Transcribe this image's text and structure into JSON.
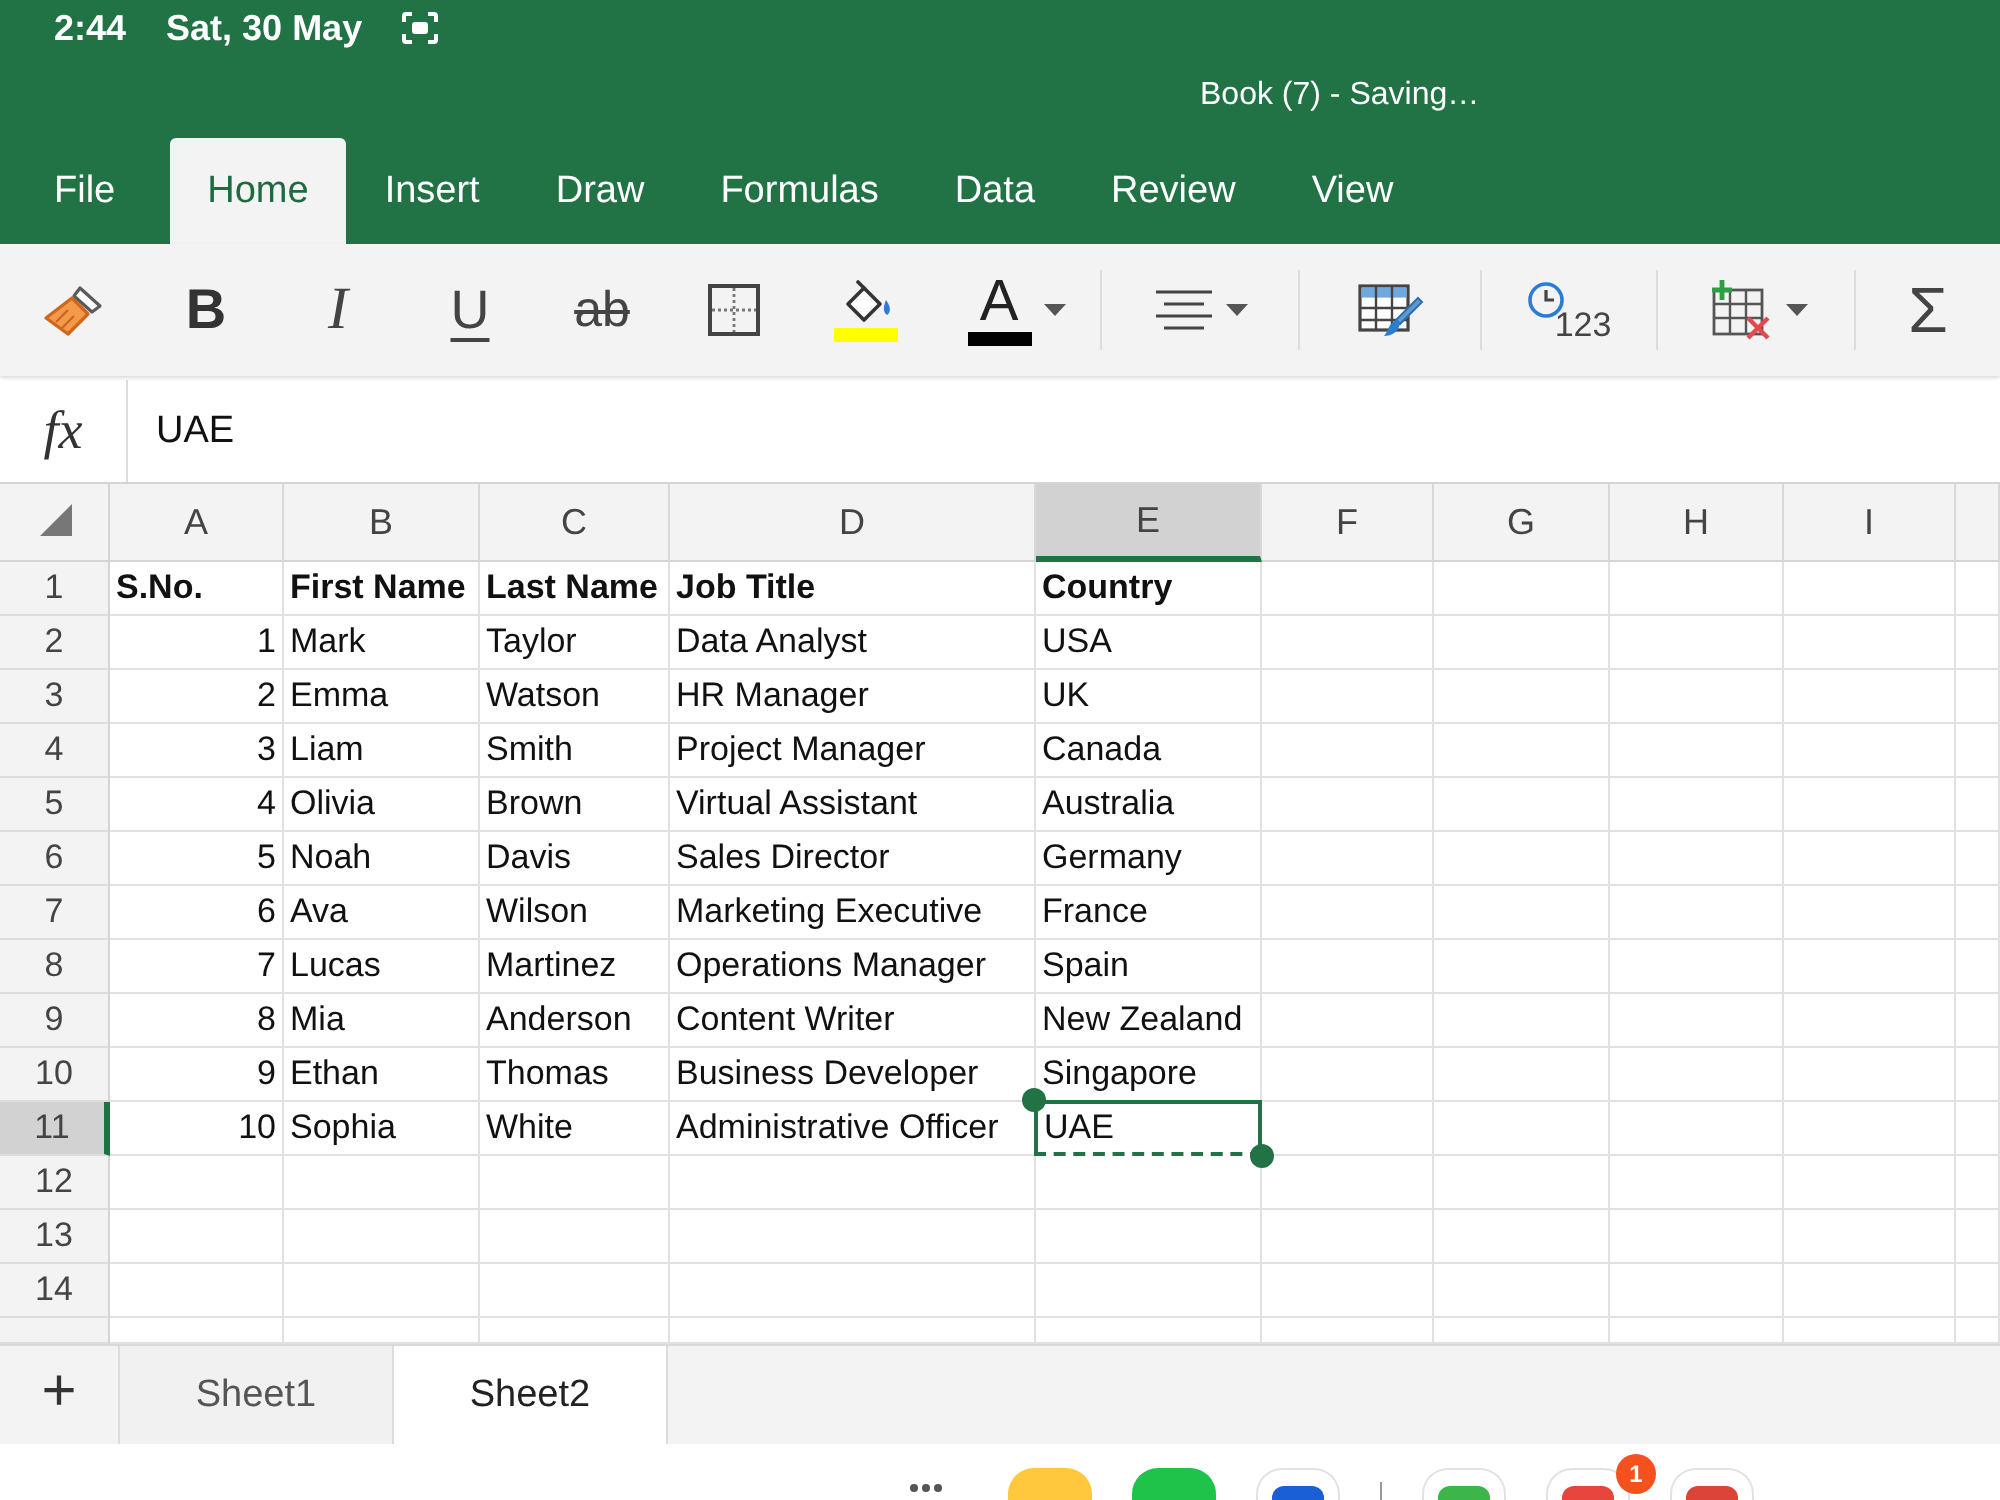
{
  "status_bar": {
    "time": "2:44",
    "date": "Sat, 30 May"
  },
  "window": {
    "title": "Book (7) - Saving…"
  },
  "ribbon_tabs": [
    {
      "label": "File",
      "selected": false
    },
    {
      "label": "Home",
      "selected": true
    },
    {
      "label": "Insert",
      "selected": false
    },
    {
      "label": "Draw",
      "selected": false
    },
    {
      "label": "Formulas",
      "selected": false
    },
    {
      "label": "Data",
      "selected": false
    },
    {
      "label": "Review",
      "selected": false
    },
    {
      "label": "View",
      "selected": false
    }
  ],
  "toolbar": {
    "groups": [
      {
        "items": [
          {
            "kind": "format-painter",
            "dropdown": false
          },
          {
            "kind": "bold",
            "text": "B",
            "dropdown": false
          },
          {
            "kind": "italic",
            "text": "I",
            "dropdown": false
          },
          {
            "kind": "underline",
            "text": "U",
            "dropdown": false
          },
          {
            "kind": "strikethrough",
            "text": "ab",
            "dropdown": false
          },
          {
            "kind": "borders",
            "dropdown": false
          },
          {
            "kind": "fill-color",
            "color": "#ffff00",
            "dropdown": false
          },
          {
            "kind": "font-color",
            "text": "A",
            "color": "#000000",
            "dropdown": true
          }
        ]
      },
      {
        "items": [
          {
            "kind": "align",
            "dropdown": true
          }
        ]
      },
      {
        "items": [
          {
            "kind": "format-table",
            "dropdown": false
          }
        ]
      },
      {
        "items": [
          {
            "kind": "number-format",
            "text": "123",
            "dropdown": false
          }
        ]
      },
      {
        "items": [
          {
            "kind": "insert-delete",
            "dropdown": true
          }
        ]
      },
      {
        "items": [
          {
            "kind": "autosum",
            "text": "Σ",
            "dropdown": false
          }
        ]
      }
    ]
  },
  "formula_bar": {
    "label": "fx",
    "value": "UAE"
  },
  "table": {
    "columns": [
      {
        "label": "A",
        "selected": false
      },
      {
        "label": "B",
        "selected": false
      },
      {
        "label": "C",
        "selected": false
      },
      {
        "label": "D",
        "selected": false
      },
      {
        "label": "E",
        "selected": true
      },
      {
        "label": "F",
        "selected": false
      },
      {
        "label": "G",
        "selected": false
      },
      {
        "label": "H",
        "selected": false
      },
      {
        "label": "I",
        "selected": false
      }
    ],
    "rows": [
      {
        "label": "1",
        "selected": false,
        "bold": true,
        "cells": [
          {
            "kind": "text",
            "text": "S.No."
          },
          {
            "kind": "text",
            "text": "First Name"
          },
          {
            "kind": "text",
            "text": "Last Name"
          },
          {
            "kind": "text",
            "text": "Job Title"
          },
          {
            "kind": "text",
            "text": "Country"
          }
        ]
      },
      {
        "label": "2",
        "selected": false,
        "bold": false,
        "cells": [
          {
            "kind": "number",
            "text": "1"
          },
          {
            "kind": "text",
            "text": "Mark"
          },
          {
            "kind": "text",
            "text": "Taylor"
          },
          {
            "kind": "text",
            "text": "Data Analyst"
          },
          {
            "kind": "text",
            "text": "USA"
          }
        ]
      },
      {
        "label": "3",
        "selected": false,
        "bold": false,
        "cells": [
          {
            "kind": "number",
            "text": "2"
          },
          {
            "kind": "text",
            "text": "Emma"
          },
          {
            "kind": "text",
            "text": "Watson"
          },
          {
            "kind": "text",
            "text": "HR Manager"
          },
          {
            "kind": "text",
            "text": "UK"
          }
        ]
      },
      {
        "label": "4",
        "selected": false,
        "bold": false,
        "cells": [
          {
            "kind": "number",
            "text": "3"
          },
          {
            "kind": "text",
            "text": "Liam"
          },
          {
            "kind": "text",
            "text": "Smith"
          },
          {
            "kind": "text",
            "text": "Project Manager"
          },
          {
            "kind": "text",
            "text": "Canada"
          }
        ]
      },
      {
        "label": "5",
        "selected": false,
        "bold": false,
        "cells": [
          {
            "kind": "number",
            "text": "4"
          },
          {
            "kind": "text",
            "text": "Olivia"
          },
          {
            "kind": "text",
            "text": "Brown"
          },
          {
            "kind": "text",
            "text": "Virtual Assistant"
          },
          {
            "kind": "text",
            "text": "Australia"
          }
        ]
      },
      {
        "label": "6",
        "selected": false,
        "bold": false,
        "cells": [
          {
            "kind": "number",
            "text": "5"
          },
          {
            "kind": "text",
            "text": "Noah"
          },
          {
            "kind": "text",
            "text": "Davis"
          },
          {
            "kind": "text",
            "text": "Sales Director"
          },
          {
            "kind": "text",
            "text": "Germany"
          }
        ]
      },
      {
        "label": "7",
        "selected": false,
        "bold": false,
        "cells": [
          {
            "kind": "number",
            "text": "6"
          },
          {
            "kind": "text",
            "text": "Ava"
          },
          {
            "kind": "text",
            "text": "Wilson"
          },
          {
            "kind": "text",
            "text": "Marketing Executive"
          },
          {
            "kind": "text",
            "text": "France"
          }
        ]
      },
      {
        "label": "8",
        "selected": false,
        "bold": false,
        "cells": [
          {
            "kind": "number",
            "text": "7"
          },
          {
            "kind": "text",
            "text": "Lucas"
          },
          {
            "kind": "text",
            "text": "Martinez"
          },
          {
            "kind": "text",
            "text": "Operations Manager"
          },
          {
            "kind": "text",
            "text": "Spain"
          }
        ]
      },
      {
        "label": "9",
        "selected": false,
        "bold": false,
        "cells": [
          {
            "kind": "number",
            "text": "8"
          },
          {
            "kind": "text",
            "text": "Mia"
          },
          {
            "kind": "text",
            "text": "Anderson"
          },
          {
            "kind": "text",
            "text": "Content Writer"
          },
          {
            "kind": "text",
            "text": "New Zealand"
          }
        ]
      },
      {
        "label": "10",
        "selected": false,
        "bold": false,
        "cells": [
          {
            "kind": "number",
            "text": "9"
          },
          {
            "kind": "text",
            "text": "Ethan"
          },
          {
            "kind": "text",
            "text": "Thomas"
          },
          {
            "kind": "text",
            "text": "Business Developer"
          },
          {
            "kind": "text",
            "text": "Singapore"
          }
        ]
      },
      {
        "label": "11",
        "selected": true,
        "bold": false,
        "cells": [
          {
            "kind": "number",
            "text": "10"
          },
          {
            "kind": "text",
            "text": "Sophia"
          },
          {
            "kind": "text",
            "text": "White"
          },
          {
            "kind": "text",
            "text": "Administrative Officer"
          },
          {
            "kind": "text",
            "text": "UAE"
          }
        ]
      },
      {
        "label": "12",
        "selected": false
      },
      {
        "label": "13",
        "selected": false
      },
      {
        "label": "14",
        "selected": false
      }
    ]
  },
  "sheet_tabs": {
    "add_label": "+",
    "tabs": [
      {
        "label": "Sheet1",
        "selected": false
      },
      {
        "label": "Sheet2",
        "selected": true
      }
    ]
  },
  "dock": {
    "items": [
      {
        "kind": "more"
      },
      {
        "kind": "app",
        "color": "#ffc83d",
        "framed": false
      },
      {
        "kind": "app",
        "color": "#1fc34a",
        "framed": false
      },
      {
        "kind": "app",
        "color": "#1a5fd6",
        "framed": true
      },
      {
        "kind": "divider"
      },
      {
        "kind": "app",
        "color": "#3cb54a",
        "framed": true
      },
      {
        "kind": "app",
        "color": "#e8463c",
        "framed": true,
        "badge": "1"
      },
      {
        "kind": "app",
        "color": "#db4437",
        "framed": true
      }
    ]
  }
}
